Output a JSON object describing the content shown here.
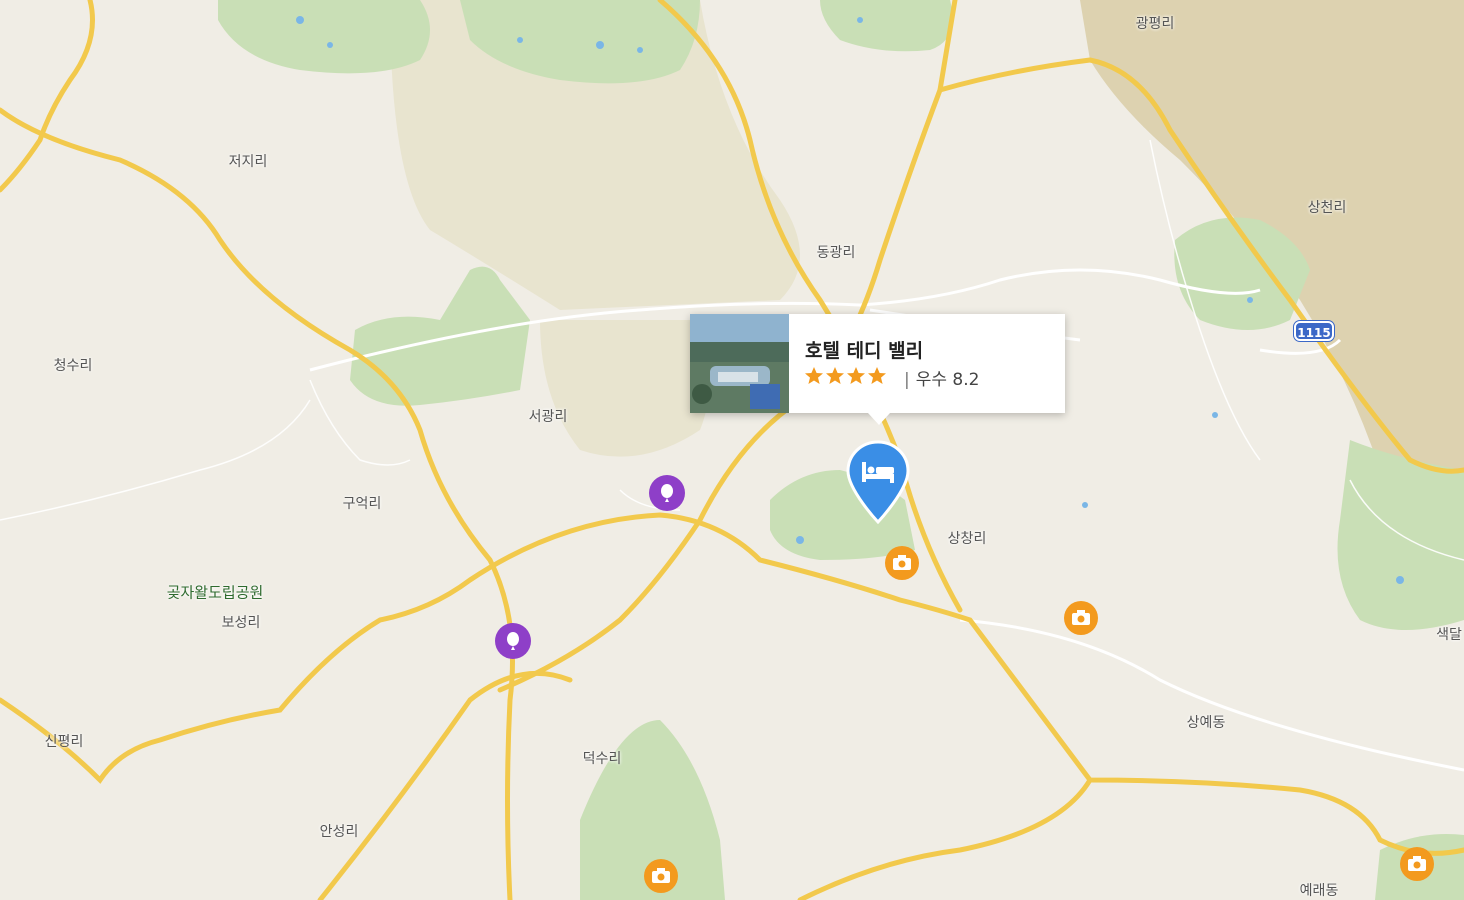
{
  "map": {
    "places": [
      {
        "id": "gwangpyeong-ri",
        "label": "광평리"
      },
      {
        "id": "jeoji-ri",
        "label": "저지리"
      },
      {
        "id": "sangcheon-ri",
        "label": "상천리"
      },
      {
        "id": "donggwang-ri",
        "label": "동광리"
      },
      {
        "id": "cheongsu-ri",
        "label": "청수리"
      },
      {
        "id": "seogwang-ri",
        "label": "서광리"
      },
      {
        "id": "gueok-ri",
        "label": "구억리"
      },
      {
        "id": "sangchang-ri",
        "label": "상창리"
      },
      {
        "id": "gotjawal-park",
        "label": "곶자왈도립공원"
      },
      {
        "id": "boseong-ri",
        "label": "보성리"
      },
      {
        "id": "saekdal",
        "label": "색달"
      },
      {
        "id": "sangye-dong",
        "label": "상예동"
      },
      {
        "id": "sinpyeong-ri",
        "label": "신평리"
      },
      {
        "id": "deoksu-ri",
        "label": "덕수리"
      },
      {
        "id": "anseong-ri",
        "label": "안성리"
      },
      {
        "id": "yerae-dong",
        "label": "예래동"
      }
    ],
    "route_shield": "1115",
    "colors": {
      "land": "#f0ede5",
      "forest": "#c8ddb0",
      "mountain": "#dccfa8",
      "yellow_road": "#f2c94c",
      "white_road": "#ffffff",
      "hotel_pin": "#3a8ee6",
      "photo_marker": "#f39a1e",
      "poi_marker": "#8e3fc8",
      "star": "#f39a1e"
    }
  },
  "popup": {
    "title": "호텔 테디 밸리",
    "stars": 4,
    "separator": "|",
    "rating_label": "우수",
    "rating_score": "8.2"
  },
  "markers": {
    "hotel_icon": "bed-icon",
    "photo_icon": "camera-icon",
    "poi_icon": "balloon-icon"
  }
}
